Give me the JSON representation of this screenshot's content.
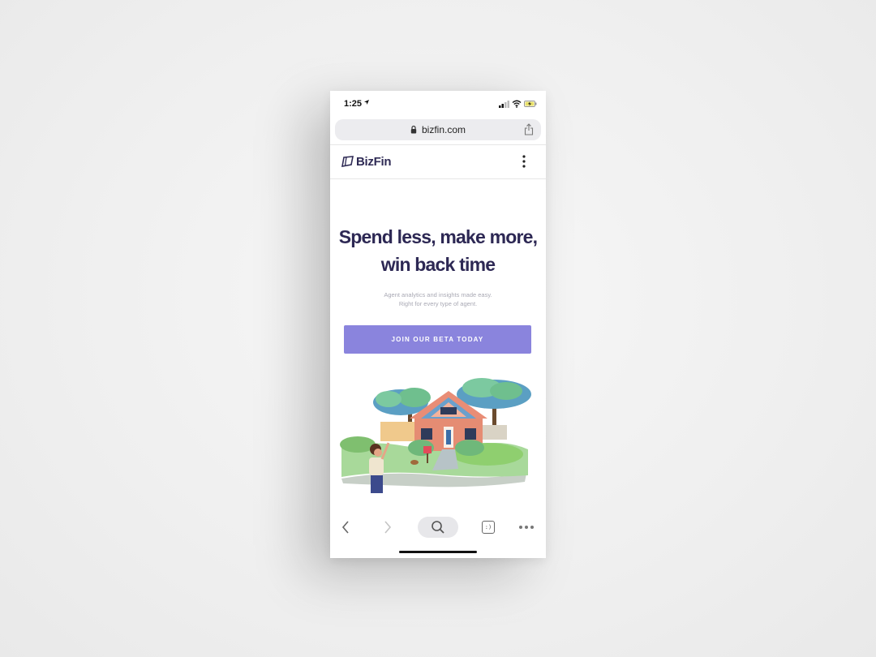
{
  "status_bar": {
    "time": "1:25"
  },
  "browser": {
    "url": "bizfin.com"
  },
  "site": {
    "logo_text": "BizFin",
    "headline_line1": "Spend less, make more,",
    "headline_line2": "win back time",
    "subtext_line1": "Agent analytics and insights made easy.",
    "subtext_line2": "Right for every type of agent.",
    "cta_label": "JOIN OUR BETA TODAY"
  },
  "toolbar": {
    "icons": [
      "back-icon",
      "forward-icon",
      "search-icon",
      "tabs-icon",
      "more-icon"
    ],
    "tabs_glyph": ":)"
  },
  "colors": {
    "brand_text": "#2d2854",
    "cta_background": "#8a84dd",
    "subtext": "#a9a9b4"
  }
}
